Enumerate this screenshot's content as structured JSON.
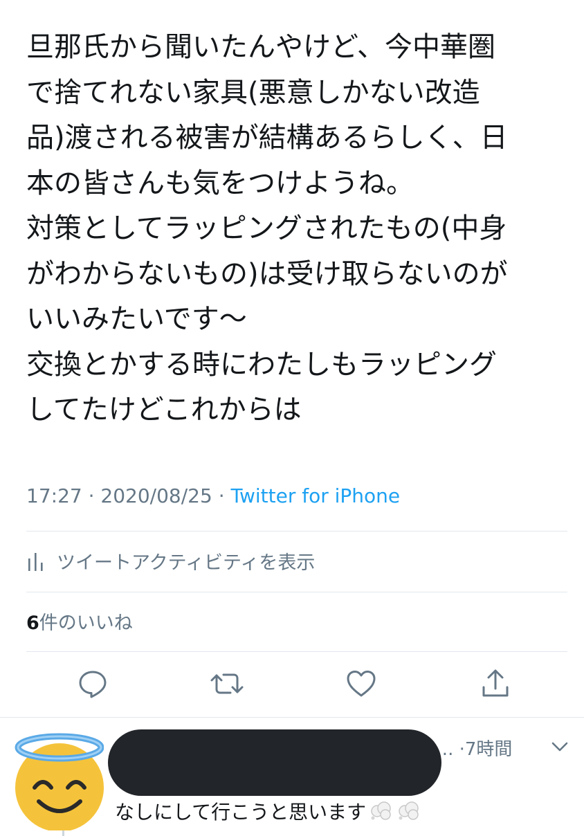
{
  "tweet": {
    "lines": [
      "旦那氏から聞いたんやけど、今中華圏",
      "で捨てれない家具(悪意しかない改造",
      "品)渡される被害が結構あるらしく、日",
      "本の皆さんも気をつけようね。",
      "対策としてラッピングされたもの(中身",
      "がわからないもの)は受け取らないのが",
      "いいみたいです〜",
      "交換とかする時にわたしもラッピング",
      "してたけどこれからは"
    ],
    "time": "17:27",
    "separator1": " · ",
    "date": "2020/08/25",
    "separator2": " · ",
    "source": "Twitter for iPhone"
  },
  "activity": {
    "label": "ツイートアクティビティを表示",
    "icon": "analytics-bar-icon"
  },
  "likes": {
    "count": "6",
    "label": "件のいいね"
  },
  "actions": [
    {
      "name": "reply",
      "icon": "speech-bubble-icon"
    },
    {
      "name": "retweet",
      "icon": "retweet-arrows-icon"
    },
    {
      "name": "like",
      "icon": "heart-icon"
    },
    {
      "name": "share",
      "icon": "share-upload-icon"
    }
  ],
  "reply": {
    "avatar_icon": "smiling-face-with-halo-icon",
    "meta": "3... ·7時間",
    "text": "なしにして行こうと思います",
    "trailing_icons": [
      "dashing-away-icon",
      "dashing-away-icon"
    ]
  },
  "colors": {
    "text": "#14171a",
    "secondary": "#657786",
    "link": "#1da1f2",
    "divider": "#e1e8ed",
    "redaction": "#222529"
  }
}
